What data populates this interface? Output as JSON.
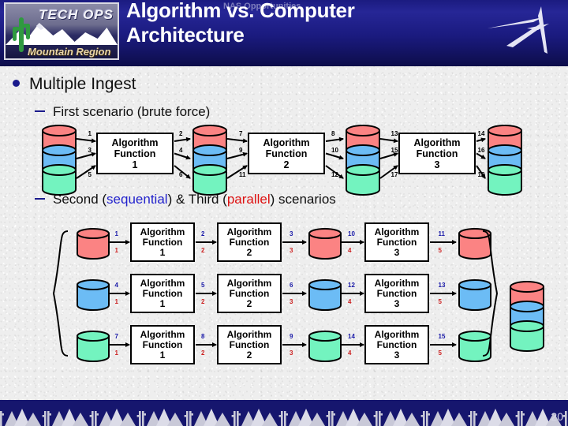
{
  "header": {
    "logo": {
      "brand": "TECH OPS",
      "region": "Mountain Region"
    },
    "title": "Algorithm vs. Computer Architecture",
    "ghost_title": "NAS Opportunities",
    "swoosh_icon": "lockheed-swoosh-icon"
  },
  "colors": {
    "header_bg": "#1b1b80",
    "footer_bg": "#16166e",
    "bullet": "#1a1a8c",
    "sequential_word": "#2222cc",
    "parallel_word": "#dd1111",
    "cyl_red": "#fb8383",
    "cyl_blue": "#6cbcf5",
    "cyl_green": "#73f3bf"
  },
  "body": {
    "bullet_main": "Multiple Ingest",
    "sub_first": "First scenario (brute force)",
    "sub_second_prefix": "Second (",
    "sub_second_seq": "sequential",
    "sub_second_mid": ") & Third (",
    "sub_second_par": "parallel",
    "sub_second_suffix": ") scenarios"
  },
  "scenario1": {
    "functions": [
      {
        "line1": "Algorithm",
        "line2": "Function",
        "line3": "1"
      },
      {
        "line1": "Algorithm",
        "line2": "Function",
        "line3": "2"
      },
      {
        "line1": "Algorithm",
        "line2": "Function",
        "line3": "3"
      }
    ],
    "stacks": [
      {
        "name": "ingest-stack",
        "layers": [
          "red",
          "blue",
          "green"
        ]
      },
      {
        "name": "stage1-stack",
        "layers": [
          "red",
          "blue",
          "green"
        ]
      },
      {
        "name": "stage2-stack",
        "layers": [
          "red",
          "blue",
          "green"
        ]
      },
      {
        "name": "output-stack",
        "layers": [
          "red",
          "blue",
          "green"
        ]
      }
    ],
    "edge_labels": {
      "in_f1": [
        "1",
        "3",
        "5"
      ],
      "out_f1": [
        "2",
        "4",
        "6"
      ],
      "in_f2": [
        "7",
        "9",
        "11"
      ],
      "out_f2": [
        "8",
        "10",
        "12"
      ],
      "in_f3": [
        "13",
        "15",
        "17"
      ],
      "out_f3": [
        "14",
        "16",
        "18"
      ]
    }
  },
  "scenario23": {
    "rows": [
      {
        "source_color": "red",
        "functions": [
          {
            "line1": "Algorithm",
            "line2": "Function",
            "line3": "1"
          },
          {
            "line1": "Algorithm",
            "line2": "Function",
            "line3": "2"
          },
          {
            "line1": "Algorithm",
            "line2": "Function",
            "line3": "3"
          }
        ],
        "mid_color": "red",
        "sequential_labels": [
          "1",
          "2",
          "3",
          "10",
          "11"
        ],
        "parallel_labels": [
          "1",
          "2",
          "3",
          "4",
          "5"
        ]
      },
      {
        "source_color": "blue",
        "functions": [
          {
            "line1": "Algorithm",
            "line2": "Function",
            "line3": "1"
          },
          {
            "line1": "Algorithm",
            "line2": "Function",
            "line3": "2"
          },
          {
            "line1": "Algorithm",
            "line2": "Function",
            "line3": "3"
          }
        ],
        "mid_color": "blue",
        "sequential_labels": [
          "4",
          "5",
          "6",
          "12",
          "13"
        ],
        "parallel_labels": [
          "1",
          "2",
          "3",
          "4",
          "5"
        ]
      },
      {
        "source_color": "green",
        "functions": [
          {
            "line1": "Algorithm",
            "line2": "Function",
            "line3": "1"
          },
          {
            "line1": "Algorithm",
            "line2": "Function",
            "line3": "2"
          },
          {
            "line1": "Algorithm",
            "line2": "Function",
            "line3": "3"
          }
        ],
        "mid_color": "green",
        "sequential_labels": [
          "7",
          "8",
          "9",
          "14",
          "15"
        ],
        "parallel_labels": [
          "1",
          "2",
          "3",
          "4",
          "5"
        ]
      }
    ],
    "merged_stack": {
      "name": "merged-output-stack",
      "layers": [
        "red",
        "blue",
        "green"
      ]
    }
  },
  "footer": {
    "page_number": "20"
  }
}
